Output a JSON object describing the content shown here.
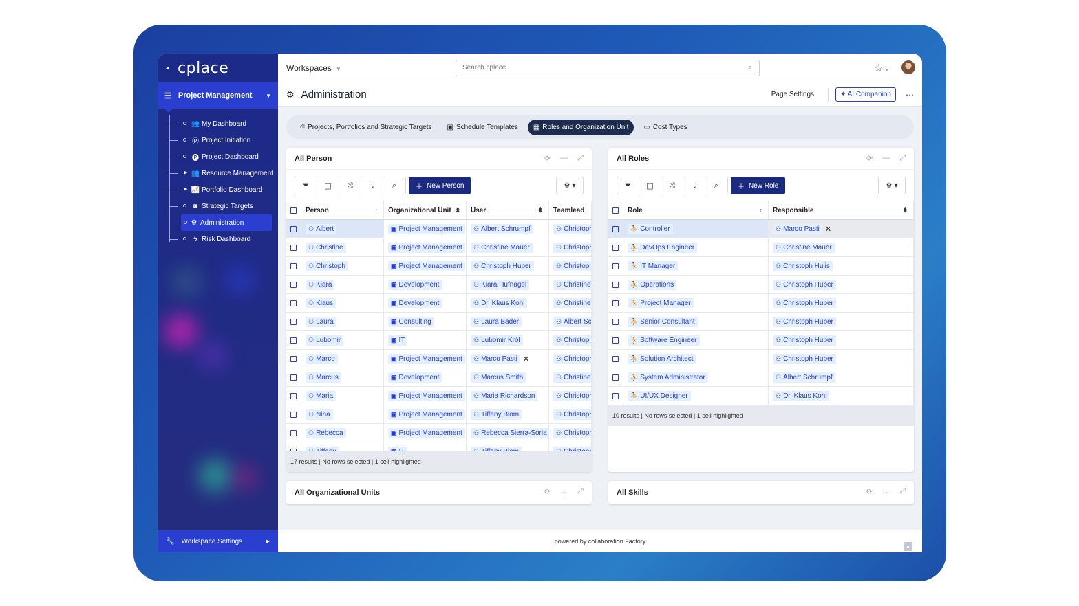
{
  "app": {
    "logo": "cplace",
    "workspace": "Project Management"
  },
  "sidebar": {
    "items": [
      {
        "label": "My Dashboard",
        "icon": "people-icon",
        "glyph": "👥",
        "expandable": false
      },
      {
        "label": "Project Initiation",
        "icon": "p-circle-icon",
        "glyph": "Ⓟ",
        "expandable": false
      },
      {
        "label": "Project Dashboard",
        "icon": "p-circle-icon",
        "glyph": "🅟",
        "expandable": false
      },
      {
        "label": "Resource Management",
        "icon": "group-icon",
        "glyph": "👥",
        "expandable": true
      },
      {
        "label": "Portfolio Dashboard",
        "icon": "chart-icon",
        "glyph": "📈",
        "expandable": true
      },
      {
        "label": "Strategic Targets",
        "icon": "target-icon",
        "glyph": "◙",
        "expandable": false
      },
      {
        "label": "Administration",
        "icon": "gears-icon",
        "glyph": "⚙",
        "expandable": false,
        "active": true
      },
      {
        "label": "Risk Dashboard",
        "icon": "bolt-icon",
        "glyph": "ϟ",
        "expandable": false
      }
    ],
    "settings_label": "Workspace Settings"
  },
  "topbar": {
    "workspaces_label": "Workspaces",
    "search_placeholder": "Search cplace"
  },
  "header": {
    "title": "Administration",
    "page_settings": "Page Settings",
    "ai_companion": "AI Companion"
  },
  "tabs": [
    {
      "label": "Projects, Portfolios and Strategic Targets",
      "glyph": "⛙"
    },
    {
      "label": "Schedule Templates",
      "glyph": "▣"
    },
    {
      "label": "Roles and Organization Unit",
      "glyph": "▦",
      "active": true
    },
    {
      "label": "Cost Types",
      "glyph": "▭"
    }
  ],
  "persons_panel": {
    "title": "All Person",
    "new_button": "New Person",
    "columns": [
      "Person",
      "Organizational Unit",
      "User",
      "Teamlead"
    ],
    "rows": [
      [
        "Albert",
        "Project Management",
        "Albert Schrumpf",
        "Christoph"
      ],
      [
        "Christine",
        "Project Management",
        "Christine Mauer",
        "Christoph"
      ],
      [
        "Christoph",
        "Project Management",
        "Christoph Huber",
        "Christoph"
      ],
      [
        "Kiara",
        "Development",
        "Kiara Hufnagel",
        "Christine"
      ],
      [
        "Klaus",
        "Development",
        "Dr. Klaus Kohl",
        "Christine"
      ],
      [
        "Laura",
        "Consulting",
        "Laura Bader",
        "Albert Sc"
      ],
      [
        "Lubomir",
        "IT",
        "Lubomir Król",
        "Christoph"
      ],
      [
        "Marco",
        "Project Management",
        "Marco Pasti",
        "Christoph"
      ],
      [
        "Marcus",
        "Development",
        "Marcus Smith",
        "Christine"
      ],
      [
        "Maria",
        "Project Management",
        "Maria Richardson",
        "Christoph"
      ],
      [
        "Nina",
        "Project Management",
        "Tiffany Blom",
        "Christoph"
      ],
      [
        "Rebecca",
        "Project Management",
        "Rebecca Sierra-Soria",
        "Christoph"
      ],
      [
        "Tiffany",
        "IT",
        "Tiffany Blom",
        "Christoph"
      ]
    ],
    "footer": "17 results | No rows selected | 1 cell highlighted"
  },
  "roles_panel": {
    "title": "All Roles",
    "new_button": "New Role",
    "columns": [
      "Role",
      "Responsible"
    ],
    "rows": [
      [
        "Controller",
        "Marco Pasti"
      ],
      [
        "DevOps Engineer",
        "Christine Mauer"
      ],
      [
        "IT Manager",
        "Christoph Hujis"
      ],
      [
        "Operations",
        "Christoph Huber"
      ],
      [
        "Project Manager",
        "Christoph Huber"
      ],
      [
        "Senior Consultant",
        "Christoph Huber"
      ],
      [
        "Software Engineer",
        "Christoph Huber"
      ],
      [
        "Solution Architect",
        "Christoph Huber"
      ],
      [
        "System Administrator",
        "Albert Schrumpf"
      ],
      [
        "UI/UX Designer",
        "Dr. Klaus Kohl"
      ]
    ],
    "footer": "10 results | No rows selected | 1 cell highlighted"
  },
  "org_units_panel": {
    "title": "All Organizational Units"
  },
  "skills_panel": {
    "title": "All Skills"
  },
  "powered_by": "powered by collaboration Factory",
  "colors": {
    "accent": "#2a3fd0",
    "sidebar": "#1f2b86",
    "dark_button": "#1c2a7d"
  }
}
